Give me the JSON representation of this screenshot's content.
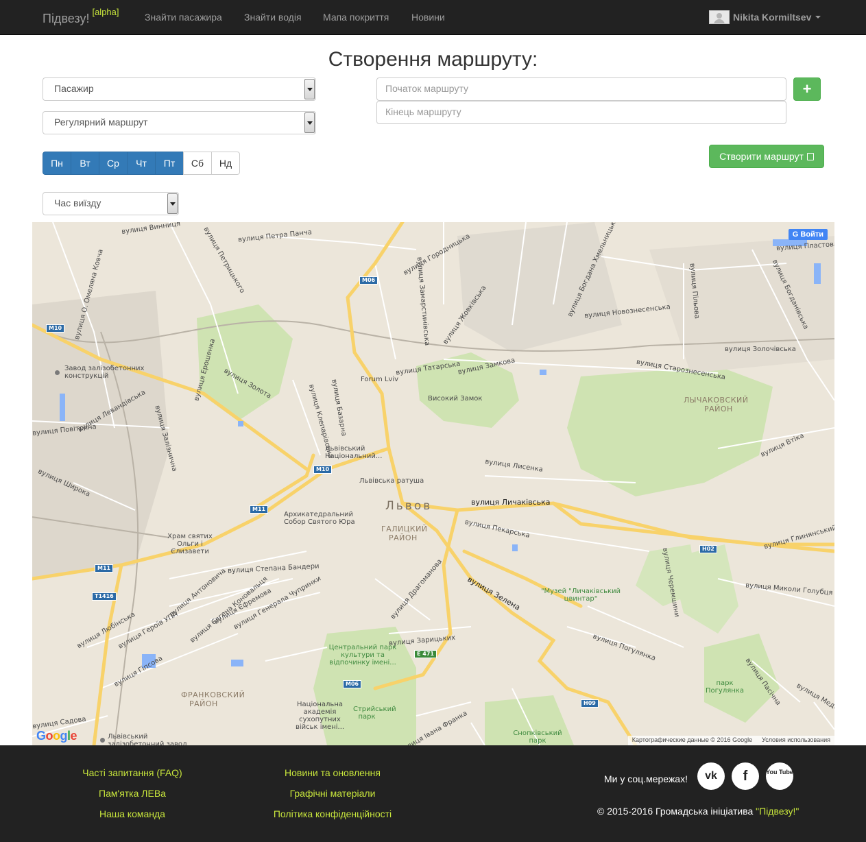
{
  "navbar": {
    "brand": "Підвезу!",
    "brand_tag": "[alpha]",
    "links": [
      "Знайти пасажира",
      "Знайти водія",
      "Мапа покриття",
      "Новини"
    ],
    "user_name": "Nikita Kormiltsev"
  },
  "form": {
    "title": "Створення маршруту:",
    "role_select": "Пасажир",
    "route_type_select": "Регулярний маршрут",
    "departure_time_select": "Час виїзду",
    "start_placeholder": "Початок маршруту",
    "end_placeholder": "Кінець маршруту",
    "add_button": "+",
    "create_button": "Створити маршрут",
    "days": [
      {
        "label": "Пн",
        "active": true
      },
      {
        "label": "Вт",
        "active": true
      },
      {
        "label": "Ср",
        "active": true
      },
      {
        "label": "Чт",
        "active": true
      },
      {
        "label": "Пт",
        "active": true
      },
      {
        "label": "Сб",
        "active": false
      },
      {
        "label": "Нд",
        "active": false
      }
    ]
  },
  "map": {
    "login_button": "Войти",
    "google_logo": "Google",
    "attribution": "Картографические данные © 2016 Google",
    "terms": "Условия использования",
    "city": "Львов",
    "districts": [
      "ЛЫЧАКОВСКИЙ",
      "РАЙОН",
      "ГАЛИЦКИЙ",
      "РАЙОН",
      "ФРАНКОВСКИЙ",
      "РАЙОН"
    ],
    "streets": [
      "вулиця Винниця",
      "вулиця Петра Панча",
      "вулиця Городницька",
      "вулиця Замарстинівська",
      "вулиця Жовківська",
      "вулиця Богдана Хмельницького",
      "вулиця Новознесенська",
      "вулиця Пластова",
      "вулиця Богданівська",
      "вулиця Пільова",
      "вулиця Золочівська",
      "вулиця Староз­несенська",
      "вулиця Татарська",
      "вулиця Замкова",
      "вулиця Золота",
      "вулиця Клепарівська",
      "вулиця Базарна",
      "вулиця Левандівська",
      "вулиця Повітряна",
      "вулиця Залізнична",
      "вулиця Широка",
      "вулиця Личаківська",
      "вулиця Пекарська",
      "вулиця Лисенка",
      "вулиця Втіка",
      "вулиця Глинянський Тракт",
      "вулиця Миколи Голубця",
      "вулиця Черемшини",
      "вулиця Зелена",
      "вулиця Погулянка",
      "вулиця Пасічна",
      "вулиця Медова",
      "вулиця Степана Бандери",
      "вулиця Антоновича",
      "вулиця Євгена Коновальця",
      "вулиця Єфремова",
      "вулиця Генерала Чупринки",
      "вулиця Героїв УПА",
      "вулиця Любінська",
      "вулиця Гіпсова",
      "вулиця Драгоманова",
      "вулиця Зарицьких",
      "вулиця Садова",
      "вулиця Івана Франка",
      "вулиця Петрицького",
      "вулиця Ерошенка",
      "вулиця О. Омеляна Ковча"
    ],
    "pois": [
      "Завод залізобетонних конструкцій",
      "Forum Lviv",
      "Високий Замок",
      "Львівський Національний...",
      "Львівська ратуша",
      "Архикатедральний Собор Святого Юра",
      "Храм святих Ольги і Єлизавети",
      "\"Музей \"Личаківський цвинтар\"",
      "Центральний парк культури та відпочинку імені...",
      "Стрийський парк",
      "Національна академія сухопутних військ імені...",
      "Снопківський парк",
      "парк Погулянка",
      "Львівський залізобетонний завод"
    ],
    "road_shields": [
      "M06",
      "M10",
      "M10",
      "M11",
      "M11",
      "T1416",
      "H02",
      "E 471",
      "M06",
      "H09"
    ]
  },
  "footer": {
    "col1": [
      "Часті запитання (FAQ)",
      "Пам'ятка ЛЕВа",
      "Наша команда"
    ],
    "col2": [
      "Новини та оновлення",
      "Графічні матеріали",
      "Політика конфіденційності"
    ],
    "social_label": "Ми у соц.мережах!",
    "social": [
      "vk",
      "f",
      "You Tube"
    ],
    "copyright": "© 2015-2016 Громадська ініціатива",
    "copyright_name": "\"Підвезу!\""
  }
}
